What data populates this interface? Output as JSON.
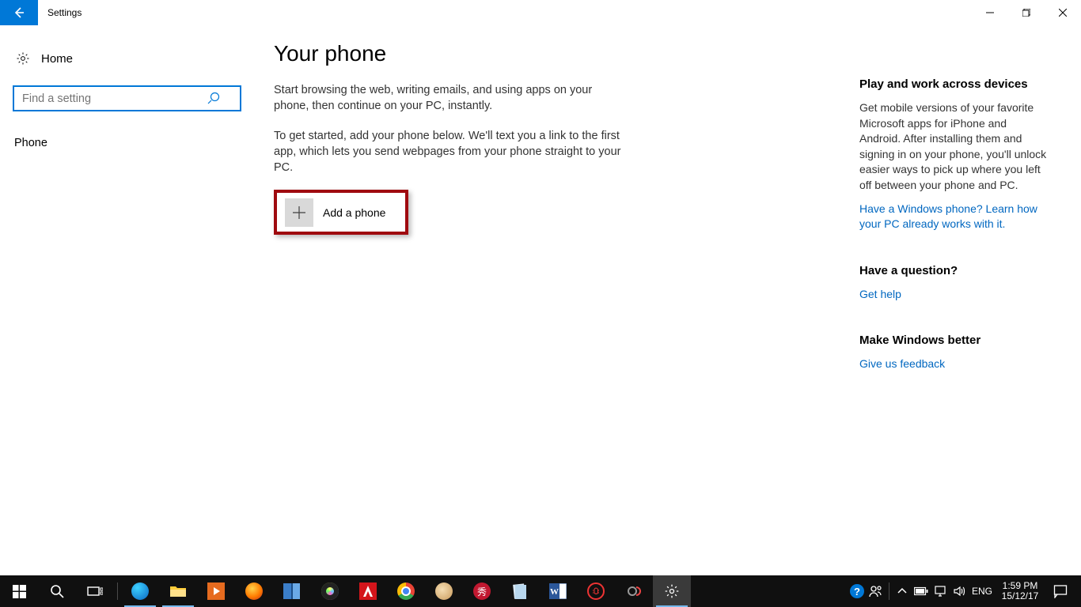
{
  "window": {
    "title": "Settings"
  },
  "sidebar": {
    "home_label": "Home",
    "search_placeholder": "Find a setting",
    "nav": {
      "phone": "Phone"
    }
  },
  "main": {
    "title": "Your phone",
    "para1": "Start browsing the web, writing emails, and using apps on your phone, then continue on your PC, instantly.",
    "para2": "To get started, add your phone below. We'll text you a link to the first app, which lets you send webpages from your phone straight to your PC.",
    "add_phone_label": "Add a phone"
  },
  "info": {
    "block1": {
      "heading": "Play and work across devices",
      "text": "Get mobile versions of your favorite Microsoft apps for iPhone and Android. After installing them and signing in on your phone, you'll unlock easier ways to pick up where you left off between your phone and PC.",
      "link": "Have a Windows phone? Learn how your PC already works with it."
    },
    "block2": {
      "heading": "Have a question?",
      "link": "Get help"
    },
    "block3": {
      "heading": "Make Windows better",
      "link": "Give us feedback"
    }
  },
  "taskbar": {
    "language": "ENG",
    "time": "1:59 PM",
    "date": "15/12/17"
  }
}
